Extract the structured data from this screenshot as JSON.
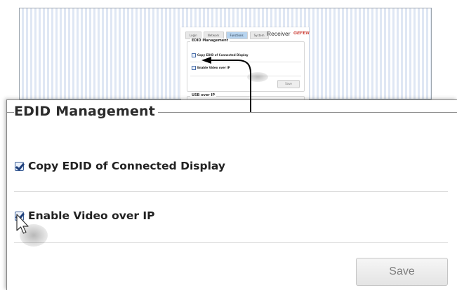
{
  "background_screenshot": {
    "tabs": [
      {
        "label": "Login",
        "active": false
      },
      {
        "label": "Network",
        "active": false
      },
      {
        "label": "Functions",
        "active": true
      },
      {
        "label": "System",
        "active": false
      }
    ],
    "title": "Receiver",
    "logo_text": "GEFEN",
    "edid_group_title": "EDID Management",
    "copy_edid_label": "Copy EDID of Connected Display",
    "enable_video_label": "Enable Video over IP",
    "save_label": "Save",
    "usb_group_title": "USB over IP"
  },
  "zoomed": {
    "group_title": "EDID Management",
    "copy_edid_label": "Copy EDID of Connected Display",
    "enable_video_label": "Enable Video over IP",
    "save_label": "Save"
  },
  "colors": {
    "checkbox_border": "#3c5f97",
    "checkmark": "#1f3f7a",
    "logo_red": "#c9362c",
    "active_tab": "#b7d4ef"
  }
}
